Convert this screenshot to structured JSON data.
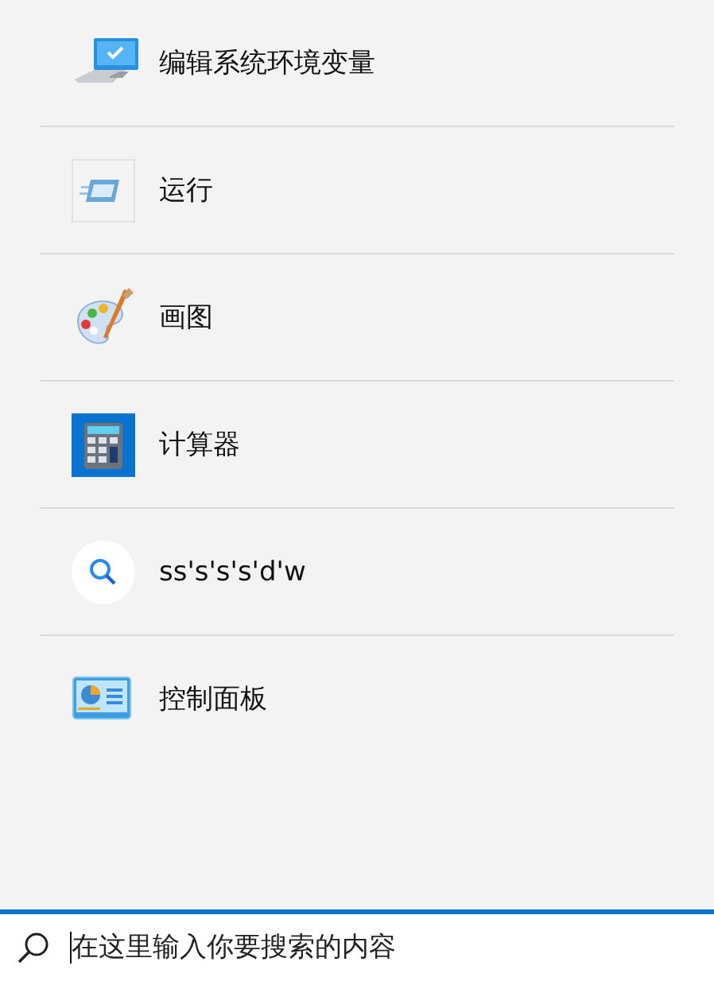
{
  "results": [
    {
      "kind": "monitor",
      "label": "编辑系统环境变量"
    },
    {
      "kind": "run",
      "label": "运行"
    },
    {
      "kind": "paint",
      "label": "画图"
    },
    {
      "kind": "calculator",
      "label": "计算器"
    },
    {
      "kind": "search",
      "label": "ss's's's'd'w"
    },
    {
      "kind": "control-panel",
      "label": "控制面板"
    }
  ],
  "search_bar": {
    "placeholder": "在这里输入你要搜索的内容"
  }
}
